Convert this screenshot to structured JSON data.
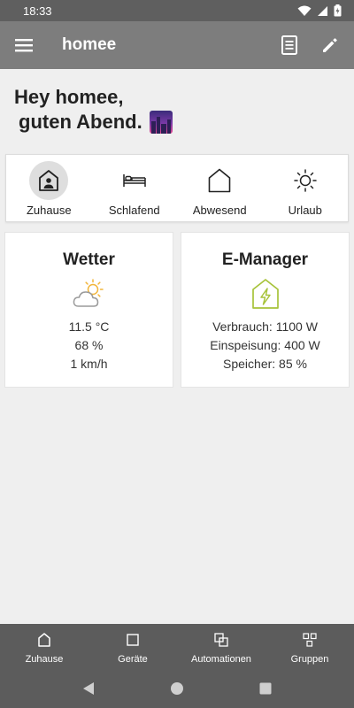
{
  "status_bar": {
    "time": "18:33",
    "icons": [
      "wifi-icon",
      "signal-icon",
      "battery-icon"
    ]
  },
  "app_bar": {
    "title": "homee",
    "icons": [
      "menu-icon",
      "log-icon",
      "edit-icon"
    ]
  },
  "greeting": {
    "line1": "Hey homee,",
    "line2": "guten Abend."
  },
  "modes": [
    {
      "label": "Zuhause",
      "icon": "home-person-icon",
      "active": true
    },
    {
      "label": "Schlafend",
      "icon": "bed-icon",
      "active": false
    },
    {
      "label": "Abwesend",
      "icon": "house-outline-icon",
      "active": false
    },
    {
      "label": "Urlaub",
      "icon": "sun-icon",
      "active": false
    }
  ],
  "weather": {
    "title": "Wetter",
    "icon": "partly-cloudy-icon",
    "temperature": "11.5 °C",
    "humidity": "68 %",
    "wind": "1 km/h"
  },
  "emanager": {
    "title": "E-Manager",
    "icon": "energy-house-icon",
    "consumption": "Verbrauch: 1100 W",
    "feed_in": "Einspeisung: 400 W",
    "storage": "Speicher: 85 %"
  },
  "bottom_nav": [
    {
      "label": "Zuhause",
      "icon": "home-icon"
    },
    {
      "label": "Geräte",
      "icon": "square-icon"
    },
    {
      "label": "Automationen",
      "icon": "automations-icon"
    },
    {
      "label": "Gruppen",
      "icon": "groups-icon"
    }
  ],
  "colors": {
    "app_bar": "#7d7d7d",
    "status_bar": "#5f5f5f",
    "bottom_nav": "#5c5c5c",
    "emanager_accent": "#a7c33a",
    "weather_sun": "#f2b53a"
  }
}
